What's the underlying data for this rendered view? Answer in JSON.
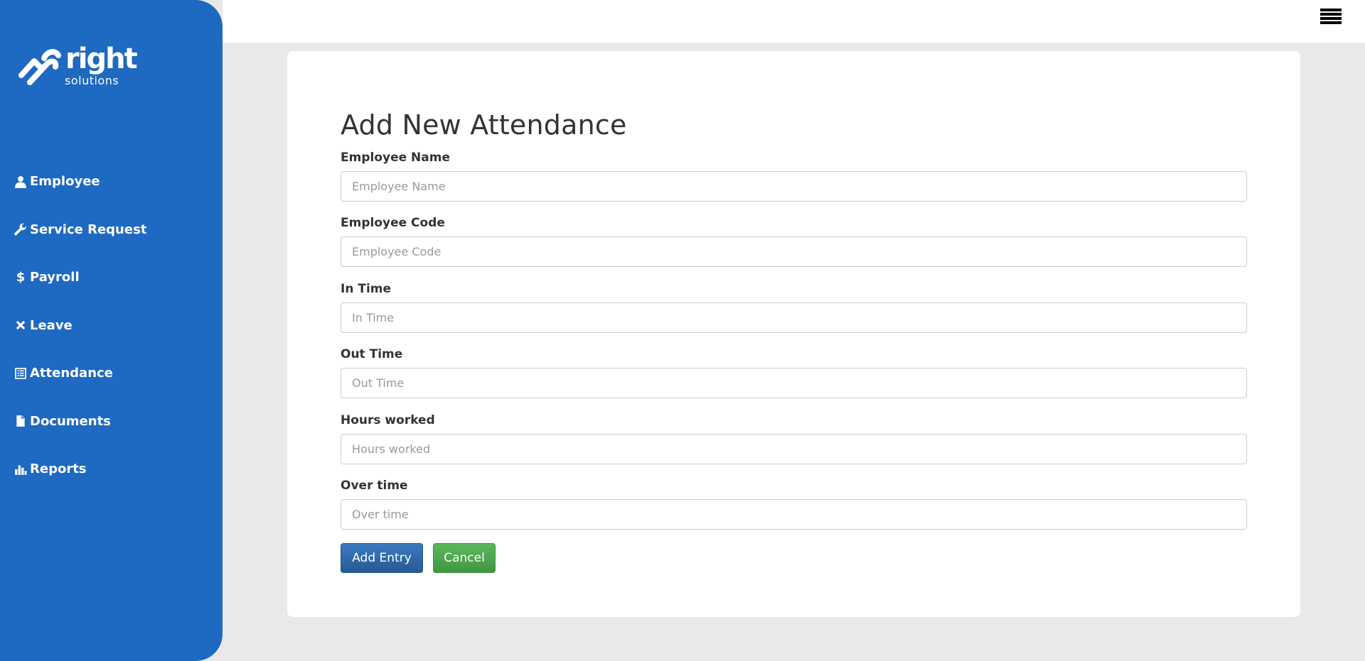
{
  "brand": {
    "name": "right",
    "tagline": "solutions"
  },
  "sidebar": {
    "items": [
      {
        "label": "Employee",
        "icon": "user-icon"
      },
      {
        "label": "Service Request",
        "icon": "wrench-icon"
      },
      {
        "label": "Payroll",
        "icon": "dollar-icon"
      },
      {
        "label": "Leave",
        "icon": "close-icon"
      },
      {
        "label": "Attendance",
        "icon": "list-alt-icon"
      },
      {
        "label": "Documents",
        "icon": "file-icon"
      },
      {
        "label": "Reports",
        "icon": "stats-icon"
      }
    ]
  },
  "topbar": {
    "menu_icon": "hamburger-icon"
  },
  "form": {
    "title": "Add New Attendance",
    "fields": [
      {
        "label": "Employee Name",
        "placeholder": "Employee Name",
        "value": ""
      },
      {
        "label": "Employee Code",
        "placeholder": "Employee Code",
        "value": ""
      },
      {
        "label": "In Time",
        "placeholder": "In Time",
        "value": ""
      },
      {
        "label": "Out Time",
        "placeholder": "Out Time",
        "value": ""
      },
      {
        "label": "Hours worked",
        "placeholder": "Hours worked",
        "value": ""
      },
      {
        "label": "Over time",
        "placeholder": "Over time",
        "value": ""
      }
    ],
    "submit_label": "Add Entry",
    "cancel_label": "Cancel"
  },
  "colors": {
    "sidebar_bg": "#1e69c1",
    "page_bg": "#e9e9e9",
    "primary_button": "#2e6da4",
    "success_button": "#4cae4c"
  }
}
